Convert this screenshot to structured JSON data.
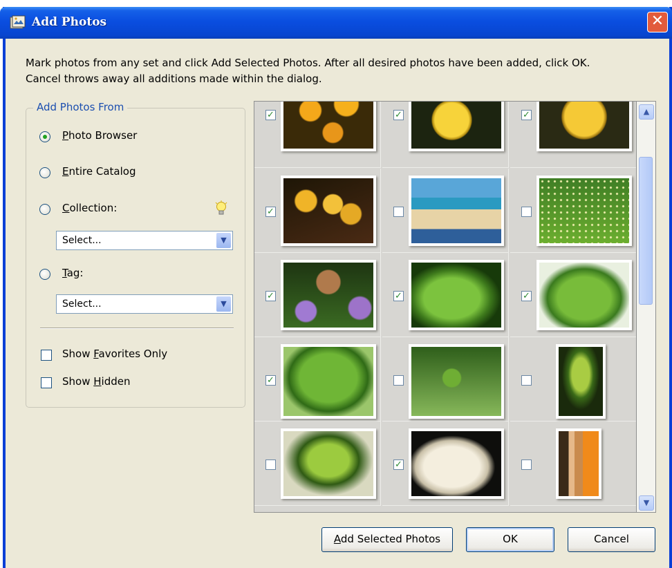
{
  "dialog": {
    "title": "Add Photos",
    "close_glyph": "✕",
    "instruction_line1": "Mark photos from any set and click Add Selected Photos. After all desired photos have been added, click OK.",
    "instruction_line2": "Cancel throws away all additions made within the dialog."
  },
  "source_group": {
    "legend": "Add Photos From",
    "options": [
      {
        "mnemonic": "P",
        "rest": "hoto Browser",
        "selected": true
      },
      {
        "mnemonic": "E",
        "rest": "ntire Catalog",
        "selected": false
      },
      {
        "mnemonic": "C",
        "rest": "ollection:",
        "selected": false
      },
      {
        "mnemonic": "T",
        "rest": "ag:",
        "selected": false
      }
    ],
    "collection_select": "Select...",
    "tag_select": "Select...",
    "show_favorites": {
      "pre": "Show ",
      "mnemonic": "F",
      "rest": "avorites Only",
      "checked": false
    },
    "show_hidden": {
      "pre": "Show ",
      "mnemonic": "H",
      "rest": "idden",
      "checked": false
    },
    "hint_icon": "lightbulb-icon"
  },
  "photos": [
    {
      "checked": true,
      "subject": "orange flowers"
    },
    {
      "checked": true,
      "subject": "yellow rose"
    },
    {
      "checked": true,
      "subject": "yellow rose closeup"
    },
    {
      "checked": true,
      "subject": "yellow fruit on branch"
    },
    {
      "checked": false,
      "subject": "child on beach"
    },
    {
      "checked": false,
      "subject": "field of small flowers"
    },
    {
      "checked": true,
      "subject": "butterfly on lavender"
    },
    {
      "checked": true,
      "subject": "fig leaf"
    },
    {
      "checked": true,
      "subject": "fig leaf"
    },
    {
      "checked": true,
      "subject": "fig leaf"
    },
    {
      "checked": false,
      "subject": "green fig"
    },
    {
      "checked": false,
      "subject": "young fig leaves"
    },
    {
      "checked": false,
      "subject": "fig sprout"
    },
    {
      "checked": true,
      "subject": "white rose"
    },
    {
      "checked": false,
      "subject": "wooden object"
    }
  ],
  "buttons": {
    "add_mnemonic": "A",
    "add_rest": "dd Selected Photos",
    "ok": "OK",
    "cancel": "Cancel"
  },
  "scroll": {
    "up": "▲",
    "down": "▼"
  }
}
